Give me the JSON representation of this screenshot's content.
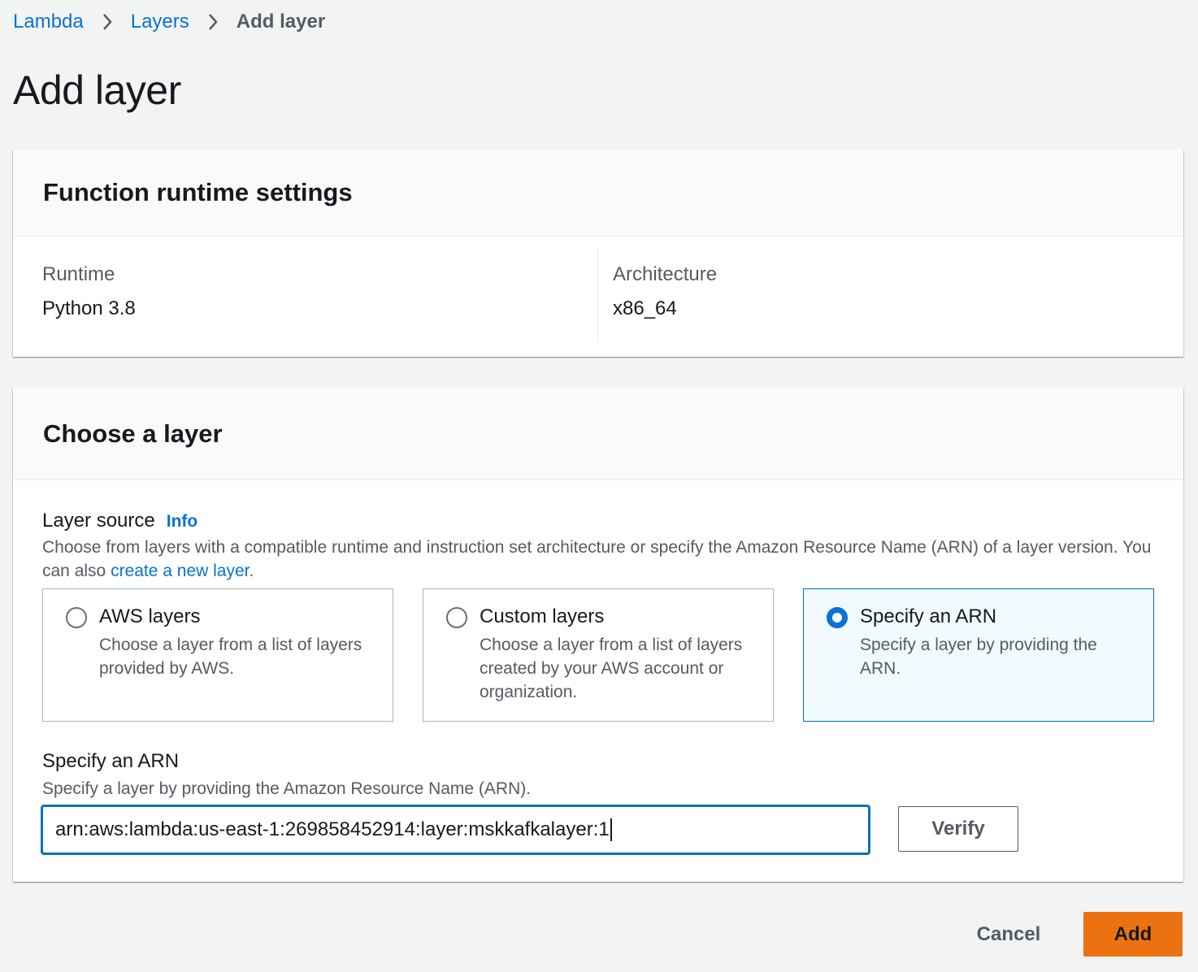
{
  "breadcrumb": {
    "items": [
      {
        "label": "Lambda"
      },
      {
        "label": "Layers"
      },
      {
        "label": "Add layer"
      }
    ]
  },
  "page_title": "Add layer",
  "runtime_settings": {
    "title": "Function runtime settings",
    "runtime_label": "Runtime",
    "runtime_value": "Python 3.8",
    "architecture_label": "Architecture",
    "architecture_value": "x86_64"
  },
  "choose_layer": {
    "title": "Choose a layer",
    "layer_source_label": "Layer source",
    "info_link": "Info",
    "description_prefix": "Choose from layers with a compatible runtime and instruction set architecture or specify the Amazon Resource Name (ARN) of a layer version. You can also ",
    "description_link": "create a new layer",
    "description_suffix": ".",
    "options": [
      {
        "title": "AWS layers",
        "description": "Choose a layer from a list of layers provided by AWS.",
        "selected": false
      },
      {
        "title": "Custom layers",
        "description": "Choose a layer from a list of layers created by your AWS account or organization.",
        "selected": false
      },
      {
        "title": "Specify an ARN",
        "description": "Specify a layer by providing the ARN.",
        "selected": true
      }
    ],
    "arn_label": "Specify an ARN",
    "arn_description": "Specify a layer by providing the Amazon Resource Name (ARN).",
    "arn_value": "arn:aws:lambda:us-east-1:269858452914:layer:mskkafkalayer:1",
    "verify_label": "Verify"
  },
  "footer": {
    "cancel_label": "Cancel",
    "add_label": "Add"
  },
  "colors": {
    "link": "#0972d3",
    "primary_button": "#ec7211",
    "selected_tile_bg": "#f1faff",
    "page_bg": "#f2f3f3"
  }
}
